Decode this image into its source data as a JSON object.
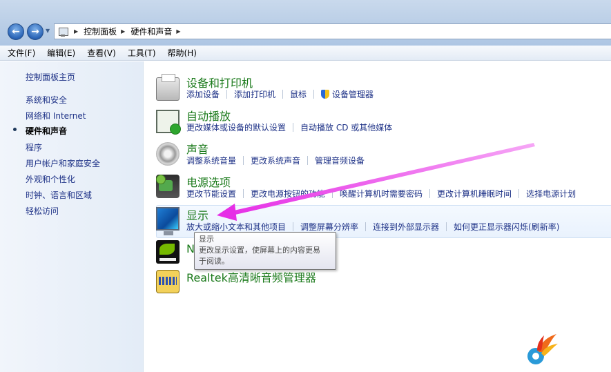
{
  "address": {
    "crumbs": [
      "控制面板",
      "硬件和声音"
    ]
  },
  "menu": [
    "文件(F)",
    "编辑(E)",
    "查看(V)",
    "工具(T)",
    "帮助(H)"
  ],
  "sidebar": {
    "items": [
      {
        "label": "控制面板主页"
      },
      {
        "label": "系统和安全"
      },
      {
        "label": "网络和 Internet"
      },
      {
        "label": "硬件和声音"
      },
      {
        "label": "程序"
      },
      {
        "label": "用户帐户和家庭安全"
      },
      {
        "label": "外观和个性化"
      },
      {
        "label": "时钟、语言和区域"
      },
      {
        "label": "轻松访问"
      }
    ]
  },
  "categories": [
    {
      "title": "设备和打印机",
      "links": [
        "添加设备",
        "添加打印机",
        "鼠标",
        "设备管理器"
      ],
      "icon": "printer-icon"
    },
    {
      "title": "自动播放",
      "links": [
        "更改媒体或设备的默认设置",
        "自动播放 CD 或其他媒体"
      ],
      "icon": "autoplay-icon"
    },
    {
      "title": "声音",
      "links": [
        "调整系统音量",
        "更改系统声音",
        "管理音频设备"
      ],
      "icon": "speaker-icon"
    },
    {
      "title": "电源选项",
      "links": [
        "更改节能设置",
        "更改电源按钮的功能",
        "唤醒计算机时需要密码",
        "更改计算机睡眠时间",
        "选择电源计划"
      ],
      "icon": "power-icon"
    },
    {
      "title": "显示",
      "links": [
        "放大或缩小文本和其他项目",
        "调整屏幕分辨率",
        "连接到外部显示器",
        "如何更正显示器闪烁(刷新率)"
      ],
      "icon": "display-icon"
    },
    {
      "title": "N",
      "links": [],
      "icon": "nvidia-icon"
    },
    {
      "title": "Realtek高清晰音频管理器",
      "links": [],
      "icon": "realtek-icon"
    }
  ],
  "tooltip": {
    "title": "显示",
    "line1": "更改显示设置，使屏幕上的内容更易",
    "line2": "于阅读。"
  },
  "colors": {
    "accent_arrow": "#e62ee6",
    "link": "#1e3287",
    "category_title": "#1b7a1b"
  }
}
